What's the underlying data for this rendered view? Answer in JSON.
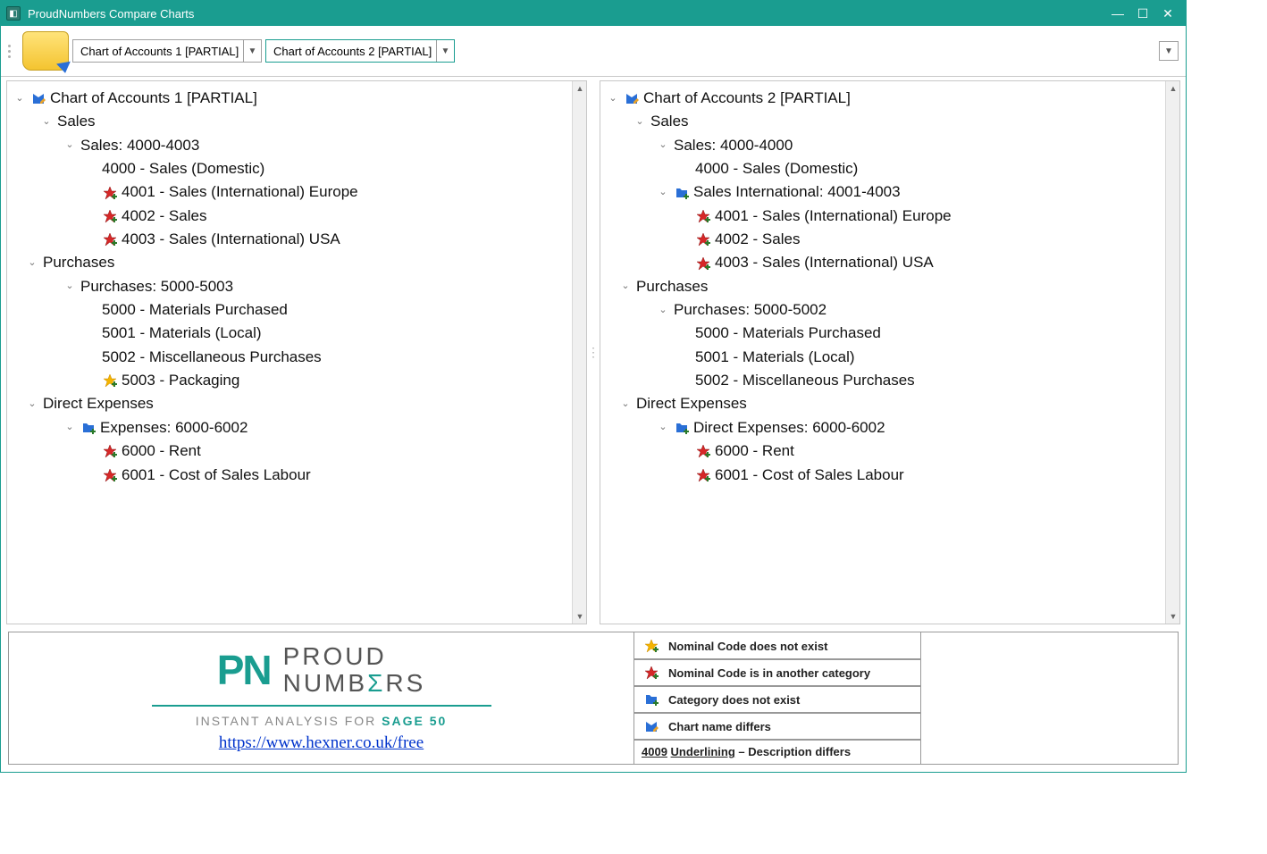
{
  "window": {
    "title": "ProudNumbers Compare Charts"
  },
  "toolbar": {
    "combo1": "Chart of Accounts 1 [PARTIAL]",
    "combo2": "Chart of Accounts 2 [PARTIAL]"
  },
  "tree_left": {
    "root": "Chart of Accounts 1 [PARTIAL]",
    "g1": "Sales",
    "g1_cat": "Sales: 4000-4003",
    "g1_i1": "4000 - Sales (Domestic)",
    "g1_i2": "4001 - Sales (International) Europe",
    "g1_i3": "4002 - Sales",
    "g1_i4": "4003 - Sales (International) USA",
    "g2": "Purchases",
    "g2_cat": "Purchases: 5000-5003",
    "g2_i1": "5000 - Materials Purchased",
    "g2_i2": "5001 - Materials (Local)",
    "g2_i3": "5002 - Miscellaneous Purchases",
    "g2_i4": "5003 - Packaging",
    "g3": "Direct Expenses",
    "g3_cat": "Expenses: 6000-6002",
    "g3_i1": "6000 - Rent",
    "g3_i2": "6001 - Cost of Sales Labour"
  },
  "tree_right": {
    "root": "Chart of Accounts 2 [PARTIAL]",
    "g1": "Sales",
    "g1_cat": "Sales: 4000-4000",
    "g1_i1": "4000 - Sales (Domestic)",
    "g1_cat2": "Sales International: 4001-4003",
    "g1_i2": "4001 - Sales (International) Europe",
    "g1_i3": "4002 - Sales",
    "g1_i4": "4003 - Sales (International) USA",
    "g2": "Purchases",
    "g2_cat": "Purchases: 5000-5002",
    "g2_i1": "5000 - Materials Purchased",
    "g2_i2": "5001 - Materials (Local)",
    "g2_i3": "5002 - Miscellaneous Purchases",
    "g3": "Direct Expenses",
    "g3_cat": "Direct Expenses: 6000-6002",
    "g3_i1": "6000 - Rent",
    "g3_i2": "6001 - Cost of Sales Labour"
  },
  "footer": {
    "brand_top": "PROUD",
    "brand_bot_pre": "NUMB",
    "brand_bot_post": "RS",
    "tag_pre": "INSTANT ANALYSIS FOR ",
    "tag_sage": "SAGE 50",
    "link": "https://www.hexner.co.uk/free"
  },
  "legend": {
    "l1": "Nominal Code does not exist",
    "l2": "Nominal Code is in another category",
    "l3": "Category does not exist",
    "l4": "Chart name differs",
    "l5a": "4009",
    "l5b": "Underlining",
    "l5c": " – Description differs"
  }
}
